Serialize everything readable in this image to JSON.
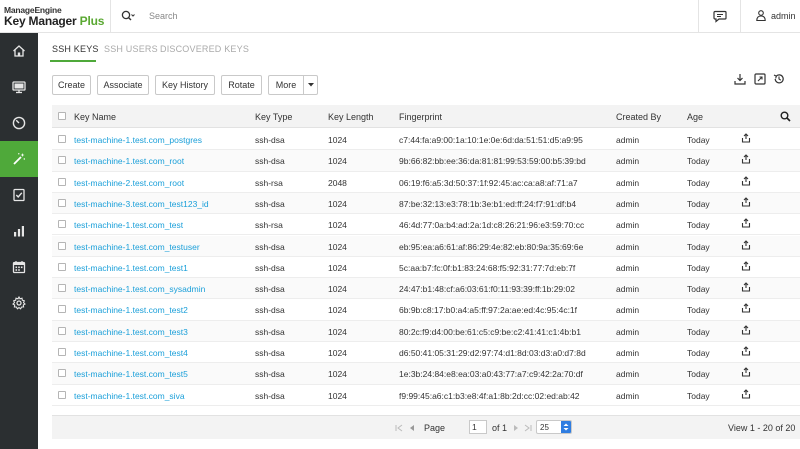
{
  "header": {
    "brand": "ManageEngine",
    "product_name": "Key Manager",
    "product_suffix": "Plus",
    "search_placeholder": "Search",
    "user_name": "admin"
  },
  "sidebar": {
    "items": [
      {
        "icon": "home-icon",
        "active": false
      },
      {
        "icon": "monitor-icon",
        "active": false
      },
      {
        "icon": "dashboard-gauge-icon",
        "active": false
      },
      {
        "icon": "magic-wand-icon",
        "active": true
      },
      {
        "icon": "checklist-icon",
        "active": false
      },
      {
        "icon": "bar-chart-icon",
        "active": false
      },
      {
        "icon": "calendar-icon",
        "active": false
      },
      {
        "icon": "gear-icon",
        "active": false
      }
    ],
    "active_color": "#4fa93a"
  },
  "tabs": [
    {
      "label": "SSH KEYS",
      "active": true
    },
    {
      "label": "SSH USERS",
      "active": false
    },
    {
      "label": "DISCOVERED KEYS",
      "active": false
    }
  ],
  "toolbar": {
    "create": "Create",
    "associate": "Associate",
    "key_history": "Key History",
    "rotate": "Rotate",
    "more": "More"
  },
  "right_tools": [
    "download-icon",
    "export-icon",
    "history-icon"
  ],
  "table": {
    "columns": [
      "Key Name",
      "Key Type",
      "Key Length",
      "Fingerprint",
      "Created By",
      "Age"
    ],
    "rows": [
      {
        "name": "test-machine-1.test.com_postgres",
        "type": "ssh-dsa",
        "length": "1024",
        "fingerprint": "c7:44:fa:a9:00:1a:10:1e:0e:6d:da:51:51:d5:a9:95",
        "created_by": "admin",
        "age": "Today"
      },
      {
        "name": "test-machine-1.test.com_root",
        "type": "ssh-dsa",
        "length": "1024",
        "fingerprint": "9b:66:82:bb:ee:36:da:81:81:99:53:59:00:b5:39:bd",
        "created_by": "admin",
        "age": "Today"
      },
      {
        "name": "test-machine-2.test.com_root",
        "type": "ssh-rsa",
        "length": "2048",
        "fingerprint": "06:19:f6:a5:3d:50:37:1f:92:45:ac:ca:a8:af:71:a7",
        "created_by": "admin",
        "age": "Today"
      },
      {
        "name": "test-machine-3.test.com_test123_id",
        "type": "ssh-dsa",
        "length": "1024",
        "fingerprint": "87:be:32:13:e3:78:1b:3e:b1:ed:ff:24:f7:91:df:b4",
        "created_by": "admin",
        "age": "Today"
      },
      {
        "name": "test-machine-1.test.com_test",
        "type": "ssh-rsa",
        "length": "1024",
        "fingerprint": "46:4d:77:0a:b4:ad:2a:1d:c8:26:21:96:e3:59:70:cc",
        "created_by": "admin",
        "age": "Today"
      },
      {
        "name": "test-machine-1.test.com_testuser",
        "type": "ssh-dsa",
        "length": "1024",
        "fingerprint": "eb:95:ea:a6:61:af:86:29:4e:82:eb:80:9a:35:69:6e",
        "created_by": "admin",
        "age": "Today"
      },
      {
        "name": "test-machine-1.test.com_test1",
        "type": "ssh-dsa",
        "length": "1024",
        "fingerprint": "5c:aa:b7:fc:0f:b1:83:24:68:f5:92:31:77:7d:eb:7f",
        "created_by": "admin",
        "age": "Today"
      },
      {
        "name": "test-machine-1.test.com_sysadmin",
        "type": "ssh-dsa",
        "length": "1024",
        "fingerprint": "24:47:b1:48:cf:a6:03:61:f0:11:93:39:ff:1b:29:02",
        "created_by": "admin",
        "age": "Today"
      },
      {
        "name": "test-machine-1.test.com_test2",
        "type": "ssh-dsa",
        "length": "1024",
        "fingerprint": "6b:9b:c8:17:b0:a4:a5:ff:97:2a:ae:ed:4c:95:4c:1f",
        "created_by": "admin",
        "age": "Today"
      },
      {
        "name": "test-machine-1.test.com_test3",
        "type": "ssh-dsa",
        "length": "1024",
        "fingerprint": "80:2c:f9:d4:00:be:61:c5:c9:be:c2:41:41:c1:4b:b1",
        "created_by": "admin",
        "age": "Today"
      },
      {
        "name": "test-machine-1.test.com_test4",
        "type": "ssh-dsa",
        "length": "1024",
        "fingerprint": "d6:50:41:05:31:29:d2:97:74:d1:8d:03:d3:a0:d7:8d",
        "created_by": "admin",
        "age": "Today"
      },
      {
        "name": "test-machine-1.test.com_test5",
        "type": "ssh-dsa",
        "length": "1024",
        "fingerprint": "1e:3b:24:84:e8:ea:03:a0:43:77:a7:c9:42:2a:70:df",
        "created_by": "admin",
        "age": "Today"
      },
      {
        "name": "test-machine-1.test.com_siva",
        "type": "ssh-dsa",
        "length": "1024",
        "fingerprint": "f9:99:45:a6:c1:b3:e8:4f:a1:8b:2d:cc:02:ed:ab:42",
        "created_by": "admin",
        "age": "Today"
      }
    ]
  },
  "pager": {
    "page_label": "Page",
    "page_value": "1",
    "of_label": "of 1",
    "page_size": "25",
    "view_text": "View 1 - 20 of 20"
  },
  "colors": {
    "accent": "#4fa93a",
    "link": "#1a9fd9",
    "sidebar_bg": "#2b2f31",
    "select_btn": "#2f7de1"
  }
}
